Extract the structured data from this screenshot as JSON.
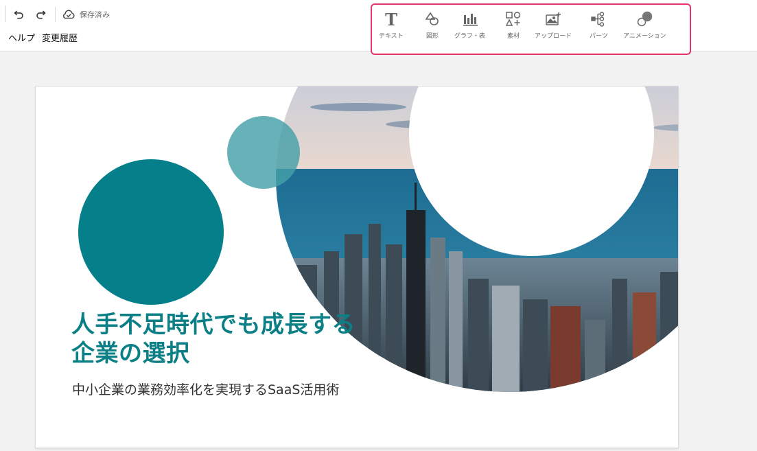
{
  "toolbar": {
    "undo_icon": "undo-icon",
    "redo_icon": "redo-icon",
    "cloud_icon": "cloud-check-icon",
    "saved_label": "保存済み"
  },
  "menu": {
    "items": [
      {
        "label": "ヘルプ"
      },
      {
        "label": "変更履歴"
      }
    ]
  },
  "tools": {
    "highlight_color": "#e8336a",
    "items": [
      {
        "label": "テキスト",
        "icon": "text-icon"
      },
      {
        "label": "図形",
        "icon": "shape-icon"
      },
      {
        "label": "グラフ・表",
        "icon": "chart-icon"
      },
      {
        "label": "素材",
        "icon": "elements-icon"
      },
      {
        "label": "アップロード",
        "icon": "upload-image-icon"
      },
      {
        "label": "パーツ",
        "icon": "parts-icon"
      },
      {
        "label": "アニメーション",
        "icon": "animation-icon"
      }
    ]
  },
  "slide": {
    "title": "人手不足時代でも成長する企業の選択",
    "subtitle": "中小企業の業務効率化を実現するSaaS活用術",
    "accent_color": "#05808a",
    "title_color": "#0b7f86",
    "photo": "city-skyline-photo"
  }
}
